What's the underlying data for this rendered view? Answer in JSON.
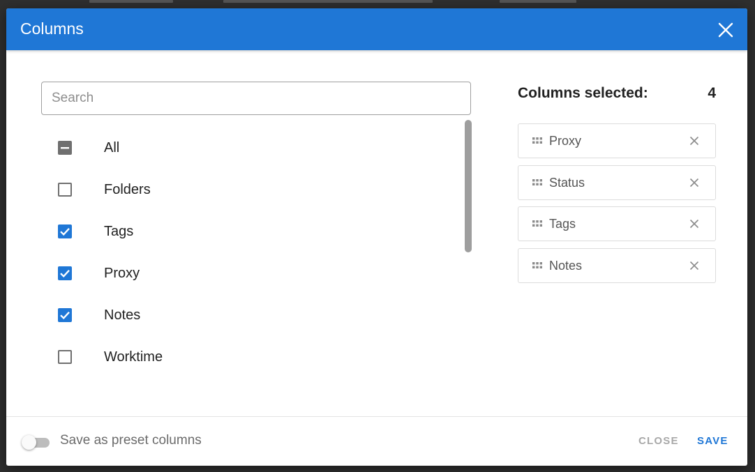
{
  "dialog": {
    "title": "Columns",
    "search": {
      "placeholder": "Search",
      "value": ""
    },
    "options": [
      {
        "label": "All",
        "state": "indeterminate"
      },
      {
        "label": "Folders",
        "state": "unchecked"
      },
      {
        "label": "Tags",
        "state": "checked"
      },
      {
        "label": "Proxy",
        "state": "checked"
      },
      {
        "label": "Notes",
        "state": "checked"
      },
      {
        "label": "Worktime",
        "state": "unchecked"
      }
    ],
    "selected": {
      "title": "Columns selected:",
      "count": "4",
      "items": [
        "Proxy",
        "Status",
        "Tags",
        "Notes"
      ]
    }
  },
  "footer": {
    "preset_label": "Save as preset columns",
    "preset_enabled": false,
    "close_label": "CLOSE",
    "save_label": "SAVE"
  },
  "colors": {
    "accent": "#1f77d6",
    "checkbox_neutral": "#6f6f6f"
  },
  "icons": {
    "close": "close-icon",
    "drag": "drag-handle-icon",
    "remove": "remove-icon",
    "check": "checkmark-icon",
    "indeterminate": "minus-icon"
  }
}
